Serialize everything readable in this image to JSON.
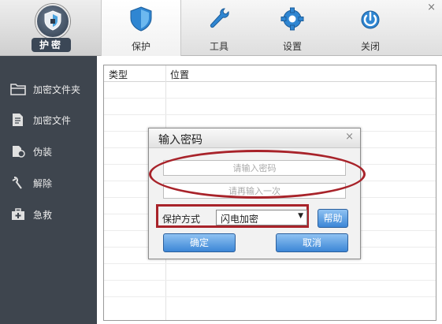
{
  "app": {
    "logo_text": "护密"
  },
  "tabs": [
    {
      "label": "保护",
      "icon": "shield-icon"
    },
    {
      "label": "工具",
      "icon": "wrench-icon"
    },
    {
      "label": "设置",
      "icon": "gear-icon"
    },
    {
      "label": "关闭",
      "icon": "power-icon"
    }
  ],
  "window": {
    "close_glyph": "×"
  },
  "sidebar": {
    "items": [
      {
        "label": "加密文件夹",
        "icon": "folder-icon"
      },
      {
        "label": "加密文件",
        "icon": "file-icon"
      },
      {
        "label": "伪装",
        "icon": "disguise-icon"
      },
      {
        "label": "解除",
        "icon": "unlock-icon"
      },
      {
        "label": "急救",
        "icon": "first-aid-icon"
      }
    ]
  },
  "table": {
    "columns": [
      "类型",
      "位置"
    ],
    "rows": []
  },
  "dialog": {
    "title": "输入密码",
    "close_glyph": "×",
    "password_placeholder": "请输入密码",
    "confirm_placeholder": "请再输入一次",
    "mode_label": "保护方式",
    "mode_value": "闪电加密",
    "help_label": "帮助",
    "ok_label": "确定",
    "cancel_label": "取消"
  },
  "colors": {
    "sidebar_bg": "#3e454e",
    "highlight_red": "#a8232a",
    "button_blue": "#3c86d6"
  }
}
